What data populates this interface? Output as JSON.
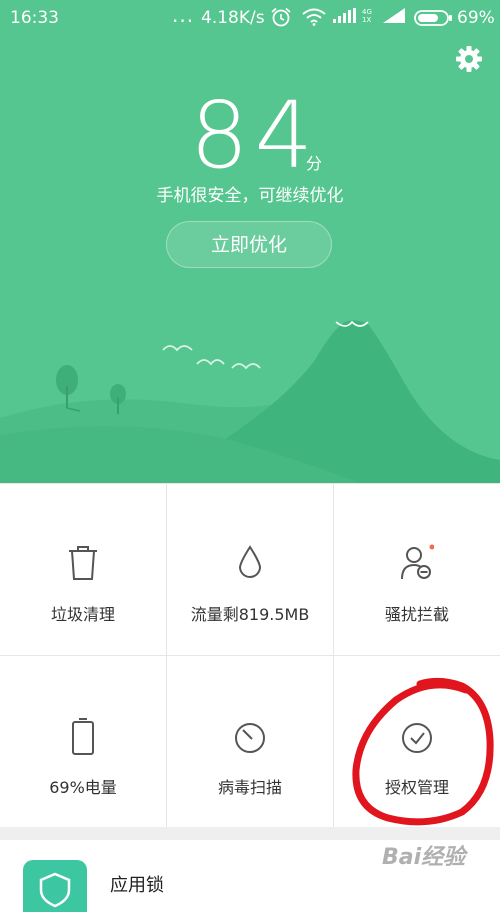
{
  "status_bar": {
    "time": "16:33",
    "dots": "...",
    "speed": "4.18K/s",
    "net_type_top": "4G",
    "net_type_bottom": "1X",
    "battery_percent": "69%"
  },
  "header": {
    "score": "84",
    "score_unit": "分",
    "subtitle": "手机很安全，可继续优化",
    "optimize_button": "立即优化"
  },
  "tools": [
    {
      "label": "垃圾清理",
      "icon": "trash-icon"
    },
    {
      "label": "流量剩819.5MB",
      "icon": "water-drop-icon"
    },
    {
      "label": "骚扰拦截",
      "icon": "block-user-icon"
    },
    {
      "label": "69%电量",
      "icon": "battery-icon"
    },
    {
      "label": "病毒扫描",
      "icon": "scan-icon"
    },
    {
      "label": "授权管理",
      "icon": "check-circle-icon"
    }
  ],
  "list": {
    "app_lock_label": "应用锁"
  },
  "watermark": "Bai经验",
  "colors": {
    "hero_green": "#55c68f",
    "hill_green": "#3fb47d",
    "icon_gray": "#555555",
    "notify_dot": "#f26b4a",
    "annotation_red": "#e0151d",
    "applock_teal": "#3cc7a2"
  }
}
